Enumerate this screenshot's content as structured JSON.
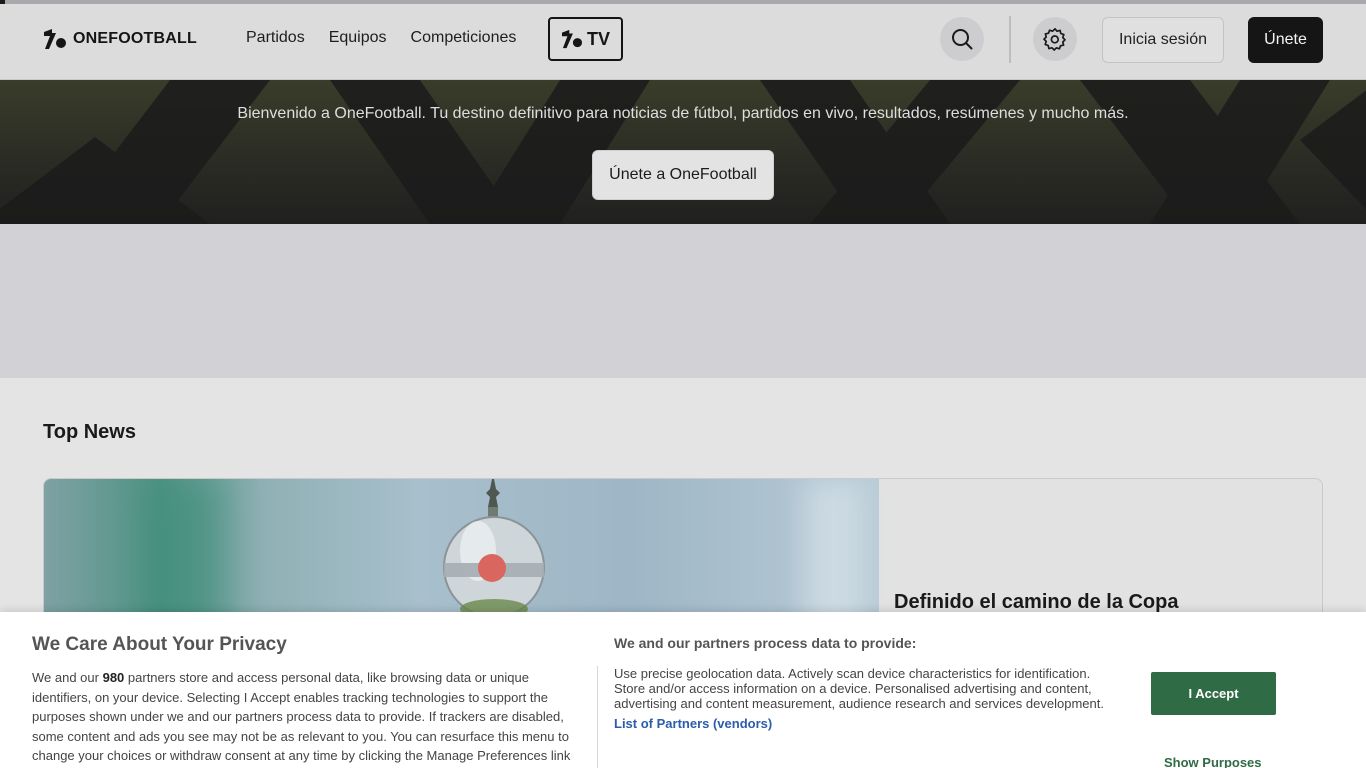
{
  "header": {
    "logo_text": "ONEFOOTBALL",
    "nav": [
      "Partidos",
      "Equipos",
      "Competiciones"
    ],
    "tv_label": "TV",
    "login_label": "Inicia sesión",
    "join_label": "Únete"
  },
  "hero": {
    "welcome_text": "Bienvenido a OneFootball. Tu destino definitivo para noticias de fútbol, partidos en vivo, resultados, resúmenes y mucho más.",
    "cta_label": "Únete a OneFootball"
  },
  "top_news": {
    "section_title": "Top News",
    "headline": "Definido el camino de la Copa"
  },
  "privacy": {
    "title": "We Care About Your Privacy",
    "body_before": "We and our ",
    "partner_count": "980",
    "body_after": " partners store and access personal data, like browsing data or unique identifiers, on your device. Selecting I Accept enables tracking technologies to support the purposes shown under we and our partners process data to provide. If trackers are disabled, some content and ads you see may not be as relevant to you. You can resurface this menu to change your choices or withdraw consent at any time by clicking the Manage Preferences link",
    "right_title": "We and our partners process data to provide:",
    "right_body": "Use precise geolocation data. Actively scan device characteristics for identification. Store and/or access information on a device. Personalised advertising and content, advertising and content measurement, audience research and services development.",
    "partners_link": "List of Partners (vendors)",
    "accept_label": "I Accept",
    "purposes_label": "Show Purposes"
  },
  "colors": {
    "brand_dark": "#151515",
    "accept_green": "#2f6b45",
    "link_blue": "#2b5dab"
  }
}
